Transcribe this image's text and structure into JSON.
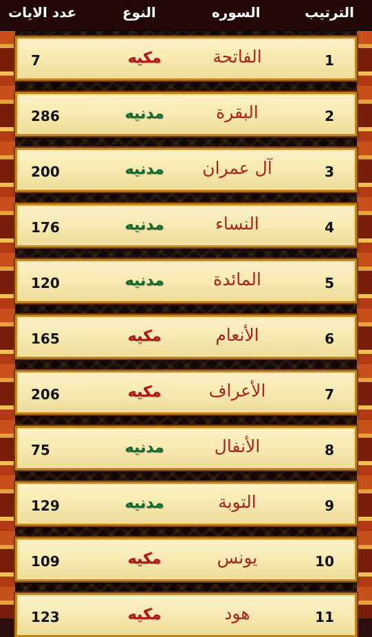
{
  "header": {
    "order_label": "الترتيب",
    "name_label": "السوره",
    "type_label": "النوع",
    "count_label": "عدد الايات"
  },
  "colors": {
    "makki": "#b3141a",
    "madani": "#126a33",
    "surah_name": "#a8231c",
    "header_bg": "#240807"
  },
  "rows": [
    {
      "order": "1",
      "name": "الفاتحة",
      "type": "مكيه",
      "kind": "makki",
      "count": "7"
    },
    {
      "order": "2",
      "name": "البقرة",
      "type": "مدنيه",
      "kind": "madani",
      "count": "286"
    },
    {
      "order": "3",
      "name": "آل عمران",
      "type": "مدنيه",
      "kind": "madani",
      "count": "200"
    },
    {
      "order": "4",
      "name": "النساء",
      "type": "مدنيه",
      "kind": "madani",
      "count": "176"
    },
    {
      "order": "5",
      "name": "المائدة",
      "type": "مدنيه",
      "kind": "madani",
      "count": "120"
    },
    {
      "order": "6",
      "name": "الأنعام",
      "type": "مكيه",
      "kind": "makki",
      "count": "165"
    },
    {
      "order": "7",
      "name": "الأعراف",
      "type": "مكيه",
      "kind": "makki",
      "count": "206"
    },
    {
      "order": "8",
      "name": "الأنفال",
      "type": "مدنيه",
      "kind": "madani",
      "count": "75"
    },
    {
      "order": "9",
      "name": "التوبة",
      "type": "مدنيه",
      "kind": "madani",
      "count": "129"
    },
    {
      "order": "10",
      "name": "يونس",
      "type": "مكيه",
      "kind": "makki",
      "count": "109"
    },
    {
      "order": "11",
      "name": "هود",
      "type": "مكيه",
      "kind": "makki",
      "count": "123"
    }
  ]
}
